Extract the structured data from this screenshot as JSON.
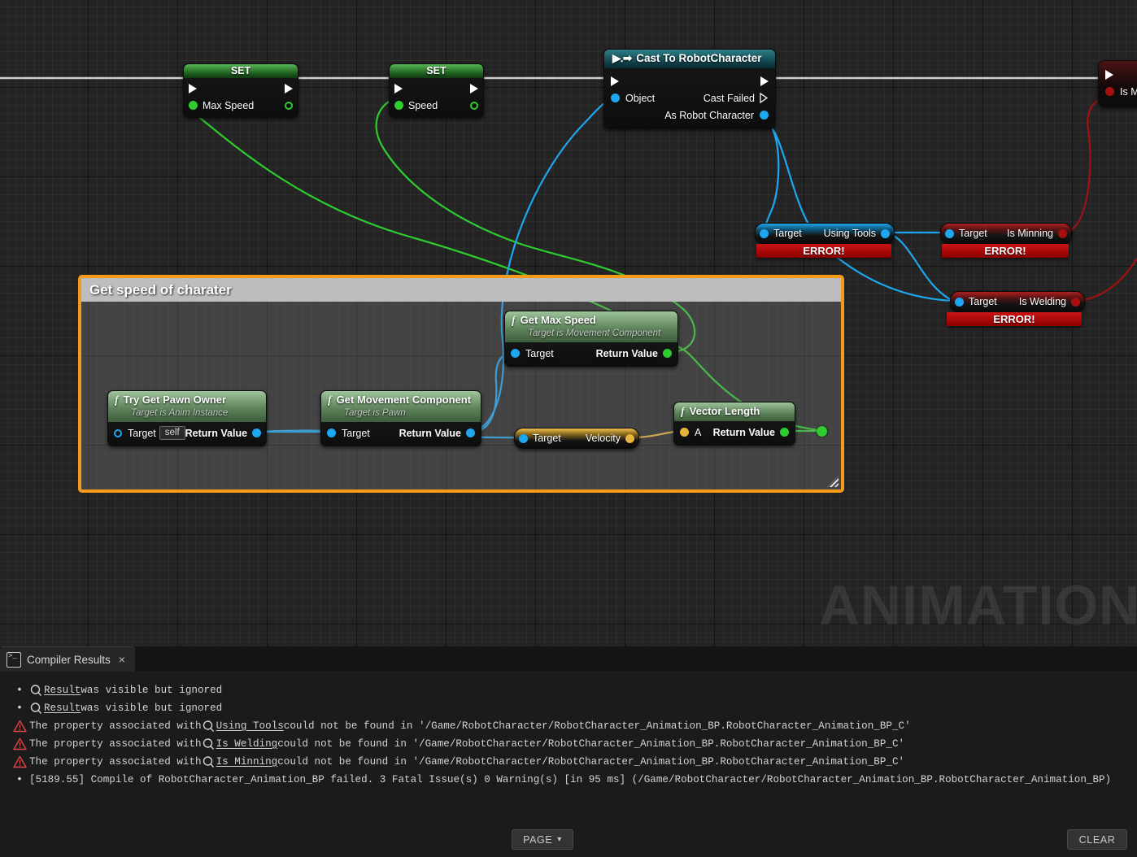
{
  "app": {
    "watermark": "ANIMATION"
  },
  "graph": {
    "comment": {
      "title": "Get speed of charater"
    },
    "nodes": {
      "set_max_speed": {
        "title": "SET",
        "pin_in": "Max Speed"
      },
      "set_speed": {
        "title": "SET",
        "pin_in": "Speed"
      },
      "cast": {
        "title": "Cast To RobotCharacter",
        "pin_object": "Object",
        "pin_cast_failed": "Cast Failed",
        "pin_as_robot": "As Robot Character"
      },
      "using_tools": {
        "pin_target": "Target",
        "pin_out": "Using Tools",
        "error": "ERROR!"
      },
      "is_minning": {
        "pin_target": "Target",
        "pin_out": "Is Minning",
        "error": "ERROR!"
      },
      "is_welding": {
        "pin_target": "Target",
        "pin_out": "Is Welding",
        "error": "ERROR!"
      },
      "is_minning_partial": {
        "pin_out": "Is Mi"
      },
      "try_get_pawn_owner": {
        "title": "Try Get Pawn Owner",
        "subtitle": "Target is Anim Instance",
        "pin_target": "Target",
        "target_value": "self",
        "pin_return": "Return Value"
      },
      "get_movement_component": {
        "title": "Get Movement Component",
        "subtitle": "Target is Pawn",
        "pin_target": "Target",
        "pin_return": "Return Value"
      },
      "get_max_speed": {
        "title": "Get Max Speed",
        "subtitle": "Target is Movement Component",
        "pin_target": "Target",
        "pin_return": "Return Value"
      },
      "velocity": {
        "pin_target": "Target",
        "pin_out": "Velocity"
      },
      "vector_length": {
        "title": "Vector Length",
        "pin_a": "A",
        "pin_return": "Return Value"
      }
    },
    "colors": {
      "exec_wire": "#cfcfcf",
      "green_wire": "#2ecc2e",
      "blue_wire": "#1ea7f0",
      "red_wire": "#9e1212",
      "gold_wire": "#e8b53c",
      "comment_border": "#f59b19",
      "error_red": "#cc1414"
    }
  },
  "bottom_panel": {
    "tab": {
      "label": "Compiler Results",
      "icon": "console-document-icon",
      "close": "×"
    },
    "log": [
      {
        "kind": "info",
        "icon": "search-icon",
        "link": "Result",
        "text": " was visible but ignored"
      },
      {
        "kind": "info",
        "icon": "search-icon",
        "link": "Result",
        "text": " was visible but ignored"
      },
      {
        "kind": "warning",
        "icon": "warning-icon",
        "pre": "The property associated with ",
        "link": "Using Tools",
        "text": " could not be found in '/Game/RobotCharacter/RobotCharacter_Animation_BP.RobotCharacter_Animation_BP_C'"
      },
      {
        "kind": "warning",
        "icon": "warning-icon",
        "pre": "The property associated with ",
        "link": "Is Welding",
        "text": " could not be found in '/Game/RobotCharacter/RobotCharacter_Animation_BP.RobotCharacter_Animation_BP_C'"
      },
      {
        "kind": "warning",
        "icon": "warning-icon",
        "pre": "The property associated with ",
        "link": "Is Minning",
        "text": " could not be found in '/Game/RobotCharacter/RobotCharacter_Animation_BP.RobotCharacter_Animation_BP_C'"
      },
      {
        "kind": "info",
        "icon": "",
        "link": "",
        "text": "[5189.55] Compile of RobotCharacter_Animation_BP failed. 3 Fatal Issue(s) 0 Warning(s) [in 95 ms] (/Game/RobotCharacter/RobotCharacter_Animation_BP.RobotCharacter_Animation_BP)"
      }
    ],
    "page_button": "PAGE",
    "clear_button": "CLEAR"
  }
}
